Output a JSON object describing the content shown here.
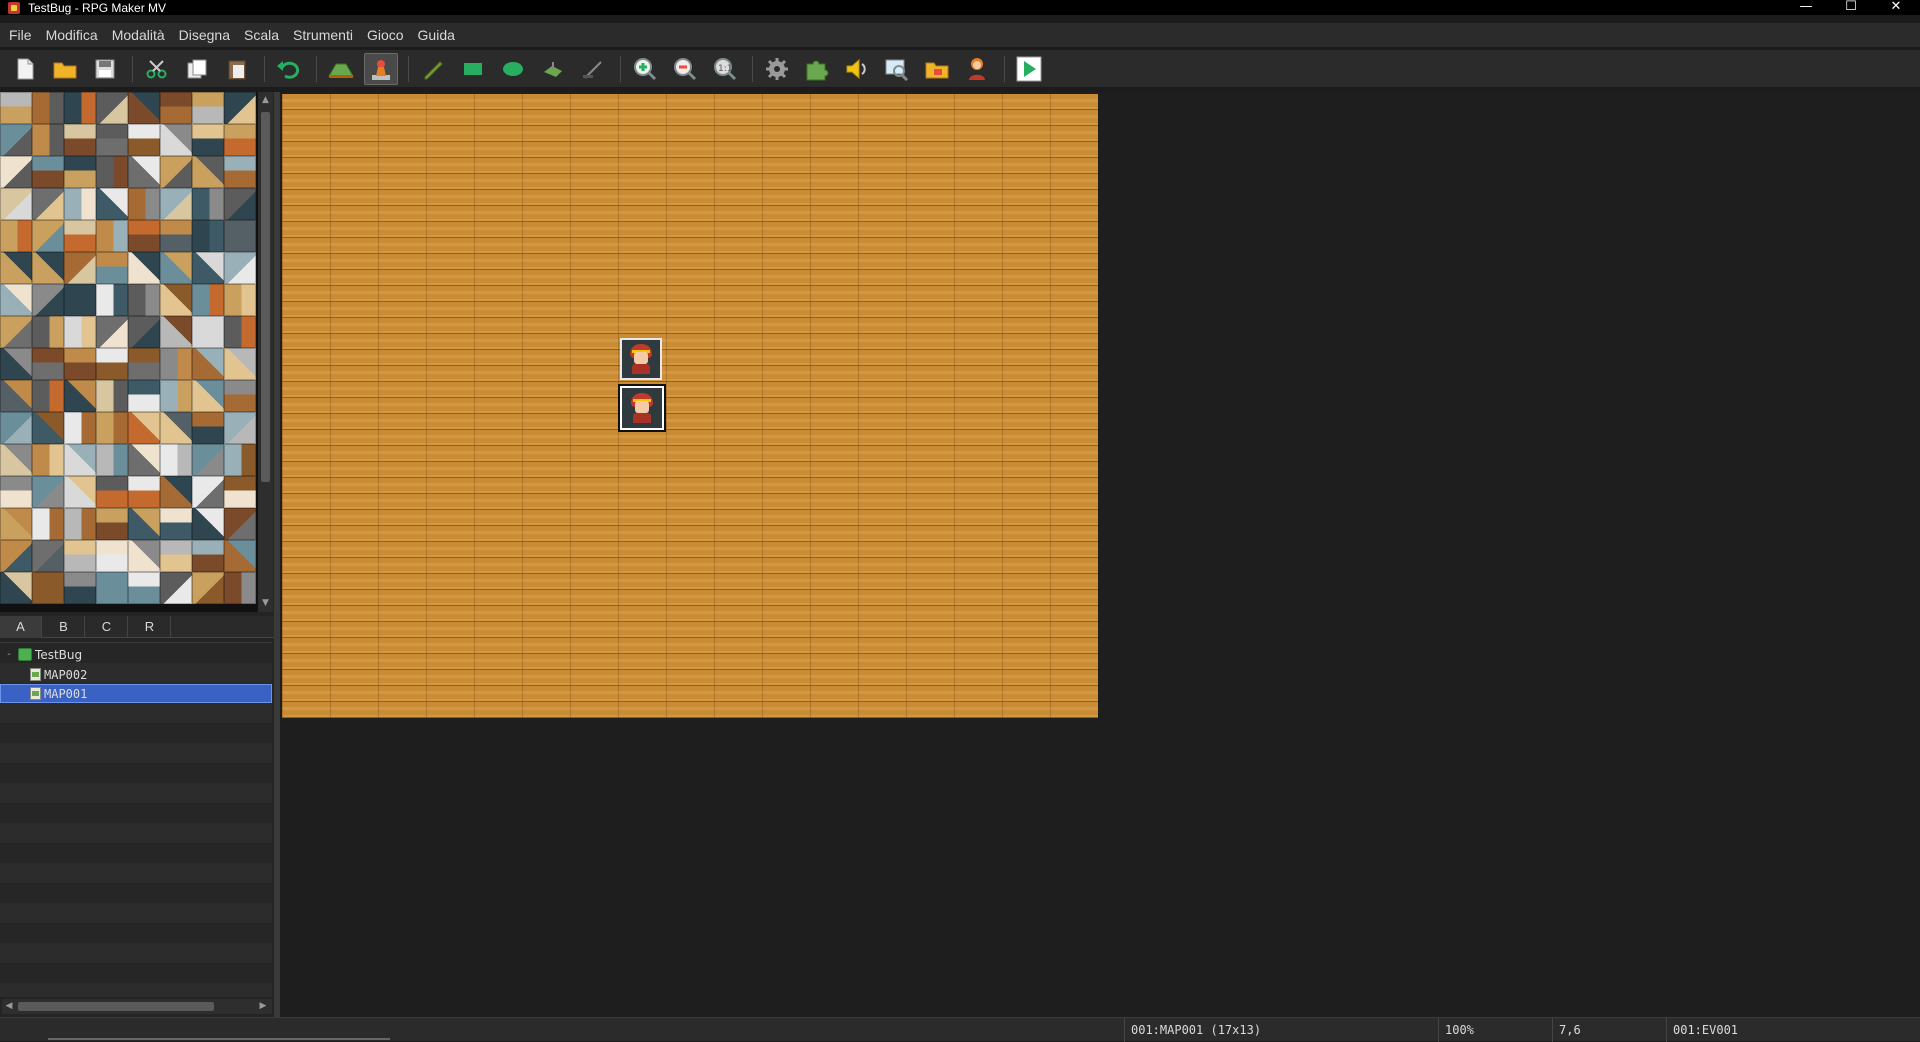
{
  "window": {
    "title": "TestBug - RPG Maker MV",
    "minimize": "—",
    "maximize": "☐",
    "close": "✕"
  },
  "menu": [
    "File",
    "Modifica",
    "Modalità",
    "Disegna",
    "Scala",
    "Strumenti",
    "Gioco",
    "Guida"
  ],
  "toolbar": {
    "buttons": [
      {
        "name": "new-project-icon",
        "active": false
      },
      {
        "name": "open-project-icon",
        "active": false
      },
      {
        "name": "save-project-icon",
        "active": false
      },
      {
        "name": "cut-icon",
        "active": false
      },
      {
        "name": "copy-icon",
        "active": false
      },
      {
        "name": "paste-icon",
        "active": false
      },
      {
        "name": "undo-icon",
        "active": false
      },
      {
        "name": "map-mode-icon",
        "active": false
      },
      {
        "name": "event-mode-icon",
        "active": true
      },
      {
        "name": "pencil-icon",
        "active": false
      },
      {
        "name": "rectangle-icon",
        "active": false
      },
      {
        "name": "ellipse-icon",
        "active": false
      },
      {
        "name": "flood-fill-icon",
        "active": false
      },
      {
        "name": "shadow-pen-icon",
        "active": false
      },
      {
        "name": "zoom-in-icon",
        "active": false
      },
      {
        "name": "zoom-out-icon",
        "active": false
      },
      {
        "name": "actual-size-icon",
        "active": false
      },
      {
        "name": "database-icon",
        "active": false
      },
      {
        "name": "plugin-manager-icon",
        "active": false
      },
      {
        "name": "sound-test-icon",
        "active": false
      },
      {
        "name": "event-searcher-icon",
        "active": false
      },
      {
        "name": "resource-manager-icon",
        "active": false
      },
      {
        "name": "character-generator-icon",
        "active": false
      },
      {
        "name": "playtest-icon",
        "active": false
      }
    ]
  },
  "tabs": [
    "A",
    "B",
    "C",
    "R"
  ],
  "tree": {
    "project": "TestBug",
    "maps": [
      {
        "label": "MAP002",
        "selected": false
      },
      {
        "label": "MAP001",
        "selected": true
      }
    ]
  },
  "status": {
    "map": "001:MAP001 (17x13)",
    "zoom": "100%",
    "coords": "7,6",
    "event": "001:EV001"
  }
}
